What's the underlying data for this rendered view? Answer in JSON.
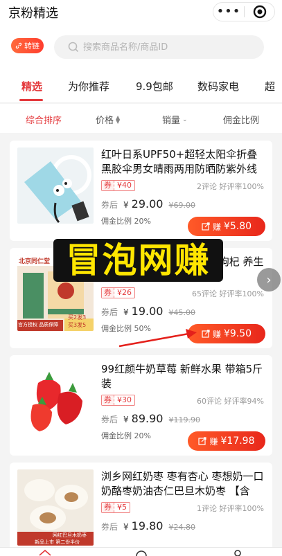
{
  "header": {
    "title": "京粉精选",
    "menu_icon": "more-dots-icon",
    "close_icon": "target-icon"
  },
  "search": {
    "convert_label": "转链",
    "placeholder": "搜索商品名称/商品ID"
  },
  "tabs": [
    {
      "label": "精选",
      "active": true
    },
    {
      "label": "为你推荐"
    },
    {
      "label": "9.9包邮"
    },
    {
      "label": "数码家电"
    },
    {
      "label": "超"
    }
  ],
  "sort": {
    "overall": "综合排序",
    "price": "价格",
    "sales": "销量",
    "commission_ratio": "佣金比例"
  },
  "labels": {
    "coupon": "券",
    "after_coupon": "券后",
    "ratio_prefix": "佣金比例",
    "earn": "赚",
    "currency": "¥"
  },
  "products": [
    {
      "title": "红叶日系UPF50+超轻太阳伞折叠黑胶伞男女晴雨两用防晒防紫外线遮...",
      "coupon": "¥40",
      "reviews": "2评论 好评率100%",
      "price": "29.00",
      "old_price": "¥69.00",
      "ratio": "20%",
      "earn": "¥5.80"
    },
    {
      "title": "北京同仁堂枸杞茶 男子茶枸杞 养生茶 根 以及 菊花草茶养...",
      "thumb_text": [
        "北京同仁堂",
        "官方授权 品质保障",
        "买2发3",
        "买3发5"
      ],
      "coupon": "¥26",
      "reviews": "65评论 好评率100%",
      "price": "19.00",
      "old_price": "¥45.00",
      "ratio": "50%",
      "earn": "¥9.50"
    },
    {
      "title": "99红颜牛奶草莓 新鲜水果 带箱5斤装",
      "coupon": "¥30",
      "reviews": "60评论 好评率94%",
      "price": "89.90",
      "old_price": "¥119.90",
      "ratio": "20%",
      "earn": "¥17.98"
    },
    {
      "title": "浏乡网红奶枣 枣有杏心 枣想奶一口 奶酪枣奶油杏仁巴旦木奶枣 【含巴...",
      "thumb_text": [
        "网红巴旦木奶枣",
        "新品上市 第二份半价"
      ],
      "coupon": "¥5",
      "reviews": "1评论 好评率100%",
      "price": "19.80",
      "old_price": "¥24.80",
      "ratio": "",
      "earn": ""
    }
  ],
  "watermark": "冒泡网赚",
  "colors": {
    "accent": "#e4393c",
    "button_start": "#ff5a28",
    "button_end": "#e8271b",
    "watermark_text": "#ffe600"
  }
}
